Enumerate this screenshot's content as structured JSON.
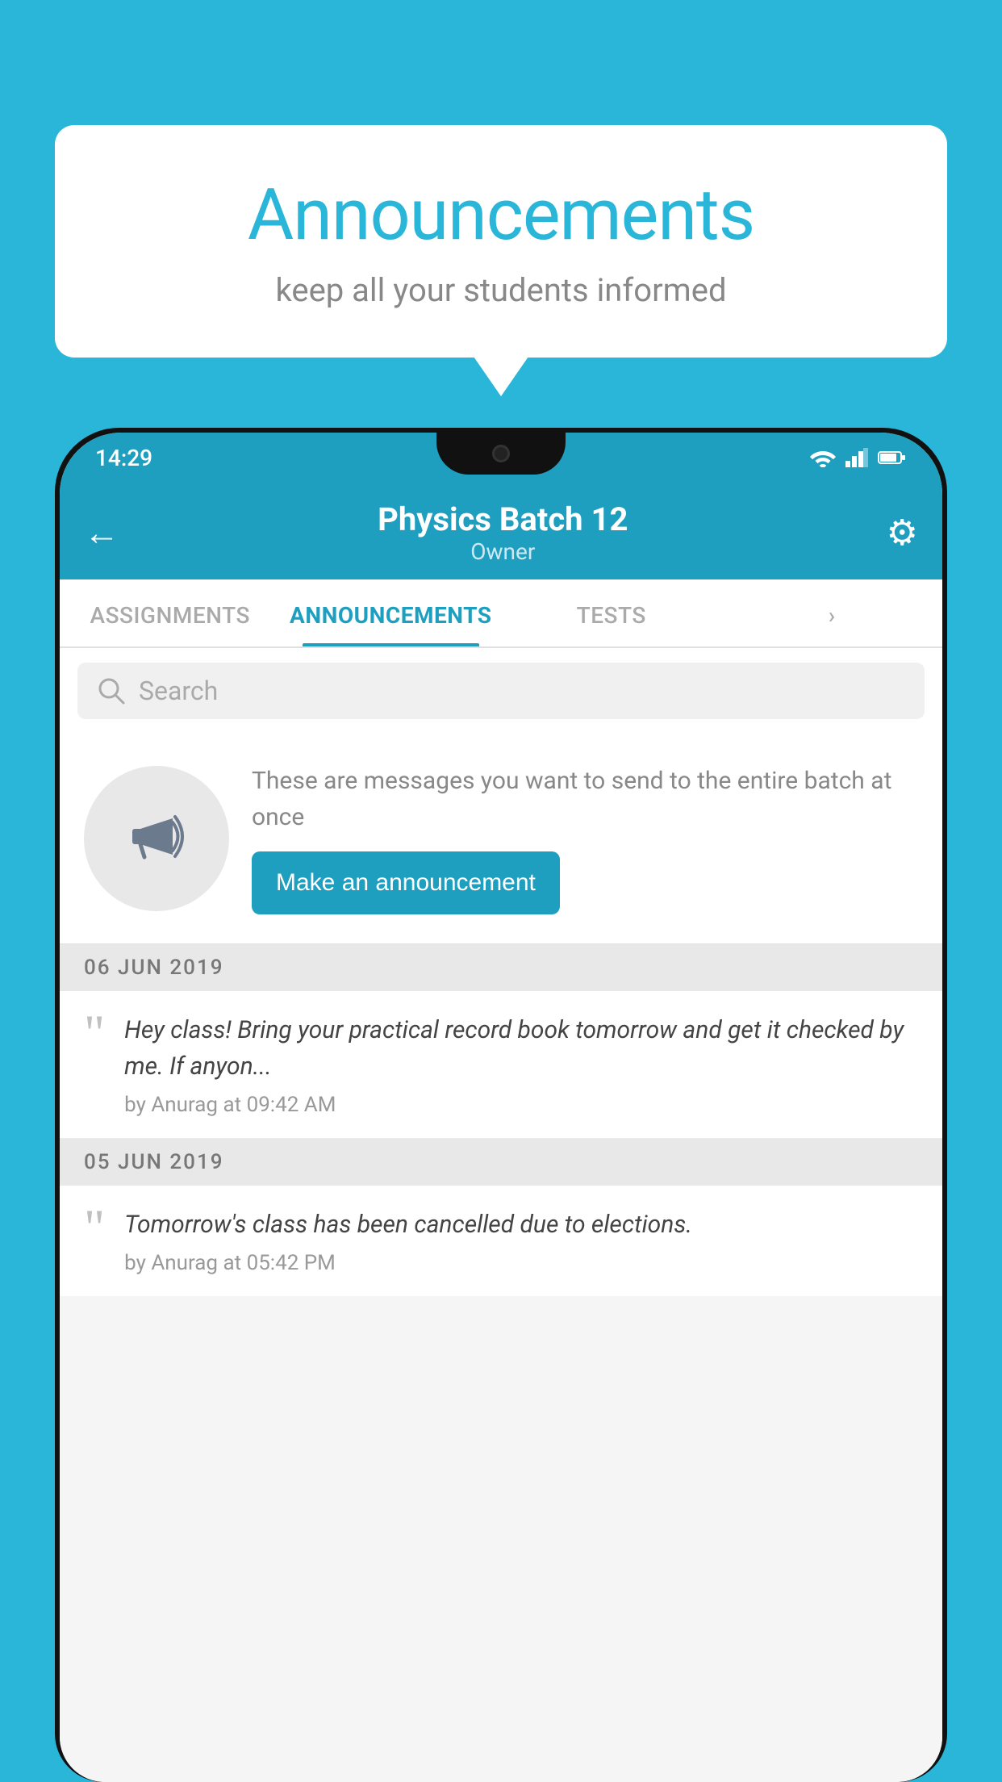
{
  "page": {
    "background_color": "#29b6d8"
  },
  "speech_bubble": {
    "title": "Announcements",
    "subtitle": "keep all your students informed"
  },
  "status_bar": {
    "time": "14:29"
  },
  "app_header": {
    "back_label": "←",
    "title": "Physics Batch 12",
    "subtitle": "Owner",
    "settings_label": "⚙"
  },
  "tabs": [
    {
      "label": "ASSIGNMENTS",
      "active": false
    },
    {
      "label": "ANNOUNCEMENTS",
      "active": true
    },
    {
      "label": "TESTS",
      "active": false
    },
    {
      "label": "›",
      "active": false
    }
  ],
  "search": {
    "placeholder": "Search"
  },
  "promo": {
    "description": "These are messages you want to send to the entire batch at once",
    "button_label": "Make an announcement"
  },
  "announcements": [
    {
      "date": "06  JUN  2019",
      "message": "Hey class! Bring your practical record book tomorrow and get it checked by me. If anyon...",
      "author": "by Anurag at 09:42 AM"
    },
    {
      "date": "05  JUN  2019",
      "message": "Tomorrow's class has been cancelled due to elections.",
      "author": "by Anurag at 05:42 PM"
    }
  ]
}
